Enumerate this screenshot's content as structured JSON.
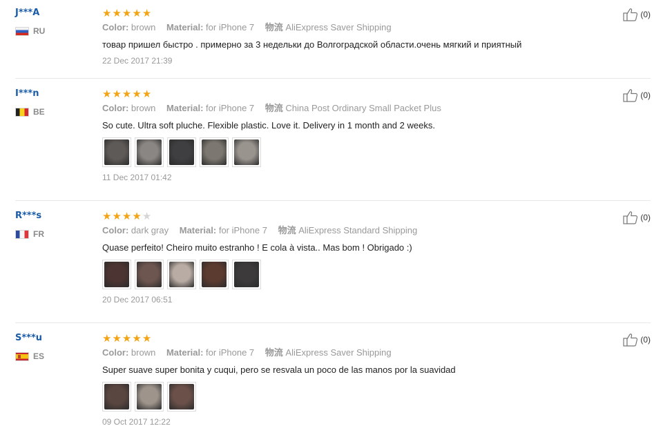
{
  "reviews": [
    {
      "user": "J***A",
      "country": "RU",
      "flag": "ru",
      "stars": 5,
      "color_label": "Color:",
      "color_value": "brown",
      "material_label": "Material:",
      "material_value": "for iPhone 7",
      "shipping_label": "物流",
      "shipping_value": "AliExpress Saver Shipping",
      "text": "товар пришел быстро . примерно за 3 недельки до Волгоградской области.очень мягкий и приятный",
      "photos": [],
      "date": "22 Dec 2017 21:39",
      "helpful": "(0)"
    },
    {
      "user": "I***n",
      "country": "BE",
      "flag": "be",
      "stars": 5,
      "color_label": "Color:",
      "color_value": "brown",
      "material_label": "Material:",
      "material_value": "for iPhone 7",
      "shipping_label": "物流",
      "shipping_value": "China Post Ordinary Small Packet Plus",
      "text": "So cute. Ultra soft pluche. Flexible plastic. Love it. Delivery in 1 month and 2 weeks.",
      "photos": [
        "#5e5a57",
        "#8a8683",
        "#3f3e40",
        "#7c7770",
        "#9a948f"
      ],
      "date": "11 Dec 2017 01:42",
      "helpful": "(0)"
    },
    {
      "user": "R***s",
      "country": "FR",
      "flag": "fr",
      "stars": 4,
      "color_label": "Color:",
      "color_value": "dark gray",
      "material_label": "Material:",
      "material_value": "for iPhone 7",
      "shipping_label": "物流",
      "shipping_value": "AliExpress Standard Shipping",
      "text": "Quase perfeito! Cheiro muito estranho ! E cola à vista.. Mas bom ! Obrigado :)",
      "photos": [
        "#4b3431",
        "#6e5650",
        "#b9aca4",
        "#5b3a30",
        "#3c3a3b"
      ],
      "date": "20 Dec 2017 06:51",
      "helpful": "(0)"
    },
    {
      "user": "S***u",
      "country": "ES",
      "flag": "es",
      "stars": 5,
      "color_label": "Color:",
      "color_value": "brown",
      "material_label": "Material:",
      "material_value": "for iPhone 7",
      "shipping_label": "物流",
      "shipping_value": "AliExpress Saver Shipping",
      "text": "Super suave super bonita y cuqui, pero se resvala un poco de las manos por la suavidad",
      "photos": [
        "#5a4640",
        "#9e948c",
        "#6a5048"
      ],
      "date": "09 Oct 2017 12:22",
      "helpful": "(0)"
    }
  ],
  "icons": {
    "like": "thumbs-up-icon",
    "star": "star-icon"
  },
  "colors": {
    "star": "#f2a414",
    "star_empty": "#d6d6d6",
    "username": "#1a5ca8",
    "meta": "#999999"
  }
}
